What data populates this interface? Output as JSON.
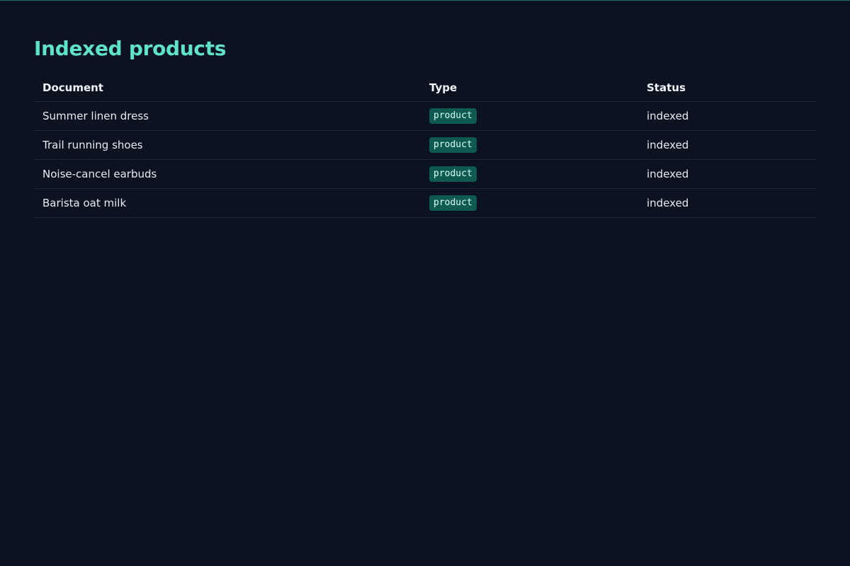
{
  "page": {
    "title": "Indexed products"
  },
  "table": {
    "headers": {
      "document": "Document",
      "type": "Type",
      "status": "Status"
    },
    "rows": [
      {
        "document": "Summer linen dress",
        "type": "product",
        "status": "indexed"
      },
      {
        "document": "Trail running shoes",
        "type": "product",
        "status": "indexed"
      },
      {
        "document": "Noise-cancel earbuds",
        "type": "product",
        "status": "indexed"
      },
      {
        "document": "Barista oat milk",
        "type": "product",
        "status": "indexed"
      }
    ]
  },
  "colors": {
    "background": "#0b1220",
    "title": "#5fe3c9",
    "badge_bg": "#0f5a50",
    "text": "#e6edf3"
  }
}
